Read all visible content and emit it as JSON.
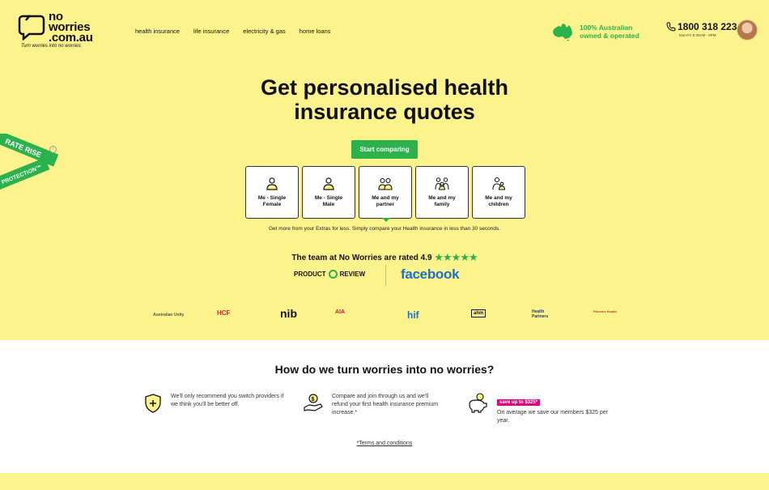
{
  "header": {
    "logo_line1": "no",
    "logo_line2": "worries",
    "logo_line3": ".com.au",
    "tagline": "Turn worries into no worries.",
    "nav": [
      "health insurance",
      "life insurance",
      "electricity & gas",
      "home loans"
    ],
    "aus_line1": "100% Australian",
    "aus_line2": "owned & operated",
    "phone": "1800 318 223",
    "phone_hours": "Mon-Fri 8:30AM - 6PM"
  },
  "ribbon": {
    "line1": "RATE RISE",
    "line2": "PROTECTION™",
    "info": "i"
  },
  "hero": {
    "title_line1": "Get personalised health",
    "title_line2": "insurance quotes",
    "cta": "Start comparing",
    "cards": [
      {
        "line1": "Me - Single",
        "line2": "Female",
        "icon": "single-female-icon"
      },
      {
        "line1": "Me - Single",
        "line2": "Male",
        "icon": "single-male-icon"
      },
      {
        "line1": "Me and my",
        "line2": "partner",
        "icon": "couple-icon"
      },
      {
        "line1": "Me and my",
        "line2": "family",
        "icon": "family-icon"
      },
      {
        "line1": "Me and my",
        "line2": "children",
        "icon": "parent-child-icon"
      }
    ],
    "subtext": "Get more from your Extras for less. Simply compare your Health insurance in less than 30 seconds.",
    "rated_text": "The team at No Worries are rated 4.9",
    "stars": "★★★★★",
    "productreview_left": "PRODUCT",
    "productreview_right": "REVIEW",
    "facebook": "facebook"
  },
  "funds": [
    "Australian Unity",
    "HCF",
    "nib",
    "AIA",
    "hif",
    "ahm",
    "Health Partners",
    "Phoenix Health"
  ],
  "how": {
    "title": "How do we turn worries into no worries?",
    "features": [
      {
        "text": "We'll only recommend you switch providers if we think you'll be better off.",
        "icon": "shield-plus-icon"
      },
      {
        "text": "Compare and join through us and we'll refund your first health insurance premium increase.*",
        "icon": "money-hand-icon"
      },
      {
        "badge": "save up to $325*",
        "text": "On average we save our members $325 per year.",
        "icon": "piggy-bank-icon"
      }
    ],
    "terms": "*Terms and conditions"
  },
  "colors": {
    "brand_yellow": "#fdf38d",
    "brand_green": "#2bb24c",
    "facebook_blue": "#1a6fd1",
    "badge_pink": "#e5007e"
  }
}
